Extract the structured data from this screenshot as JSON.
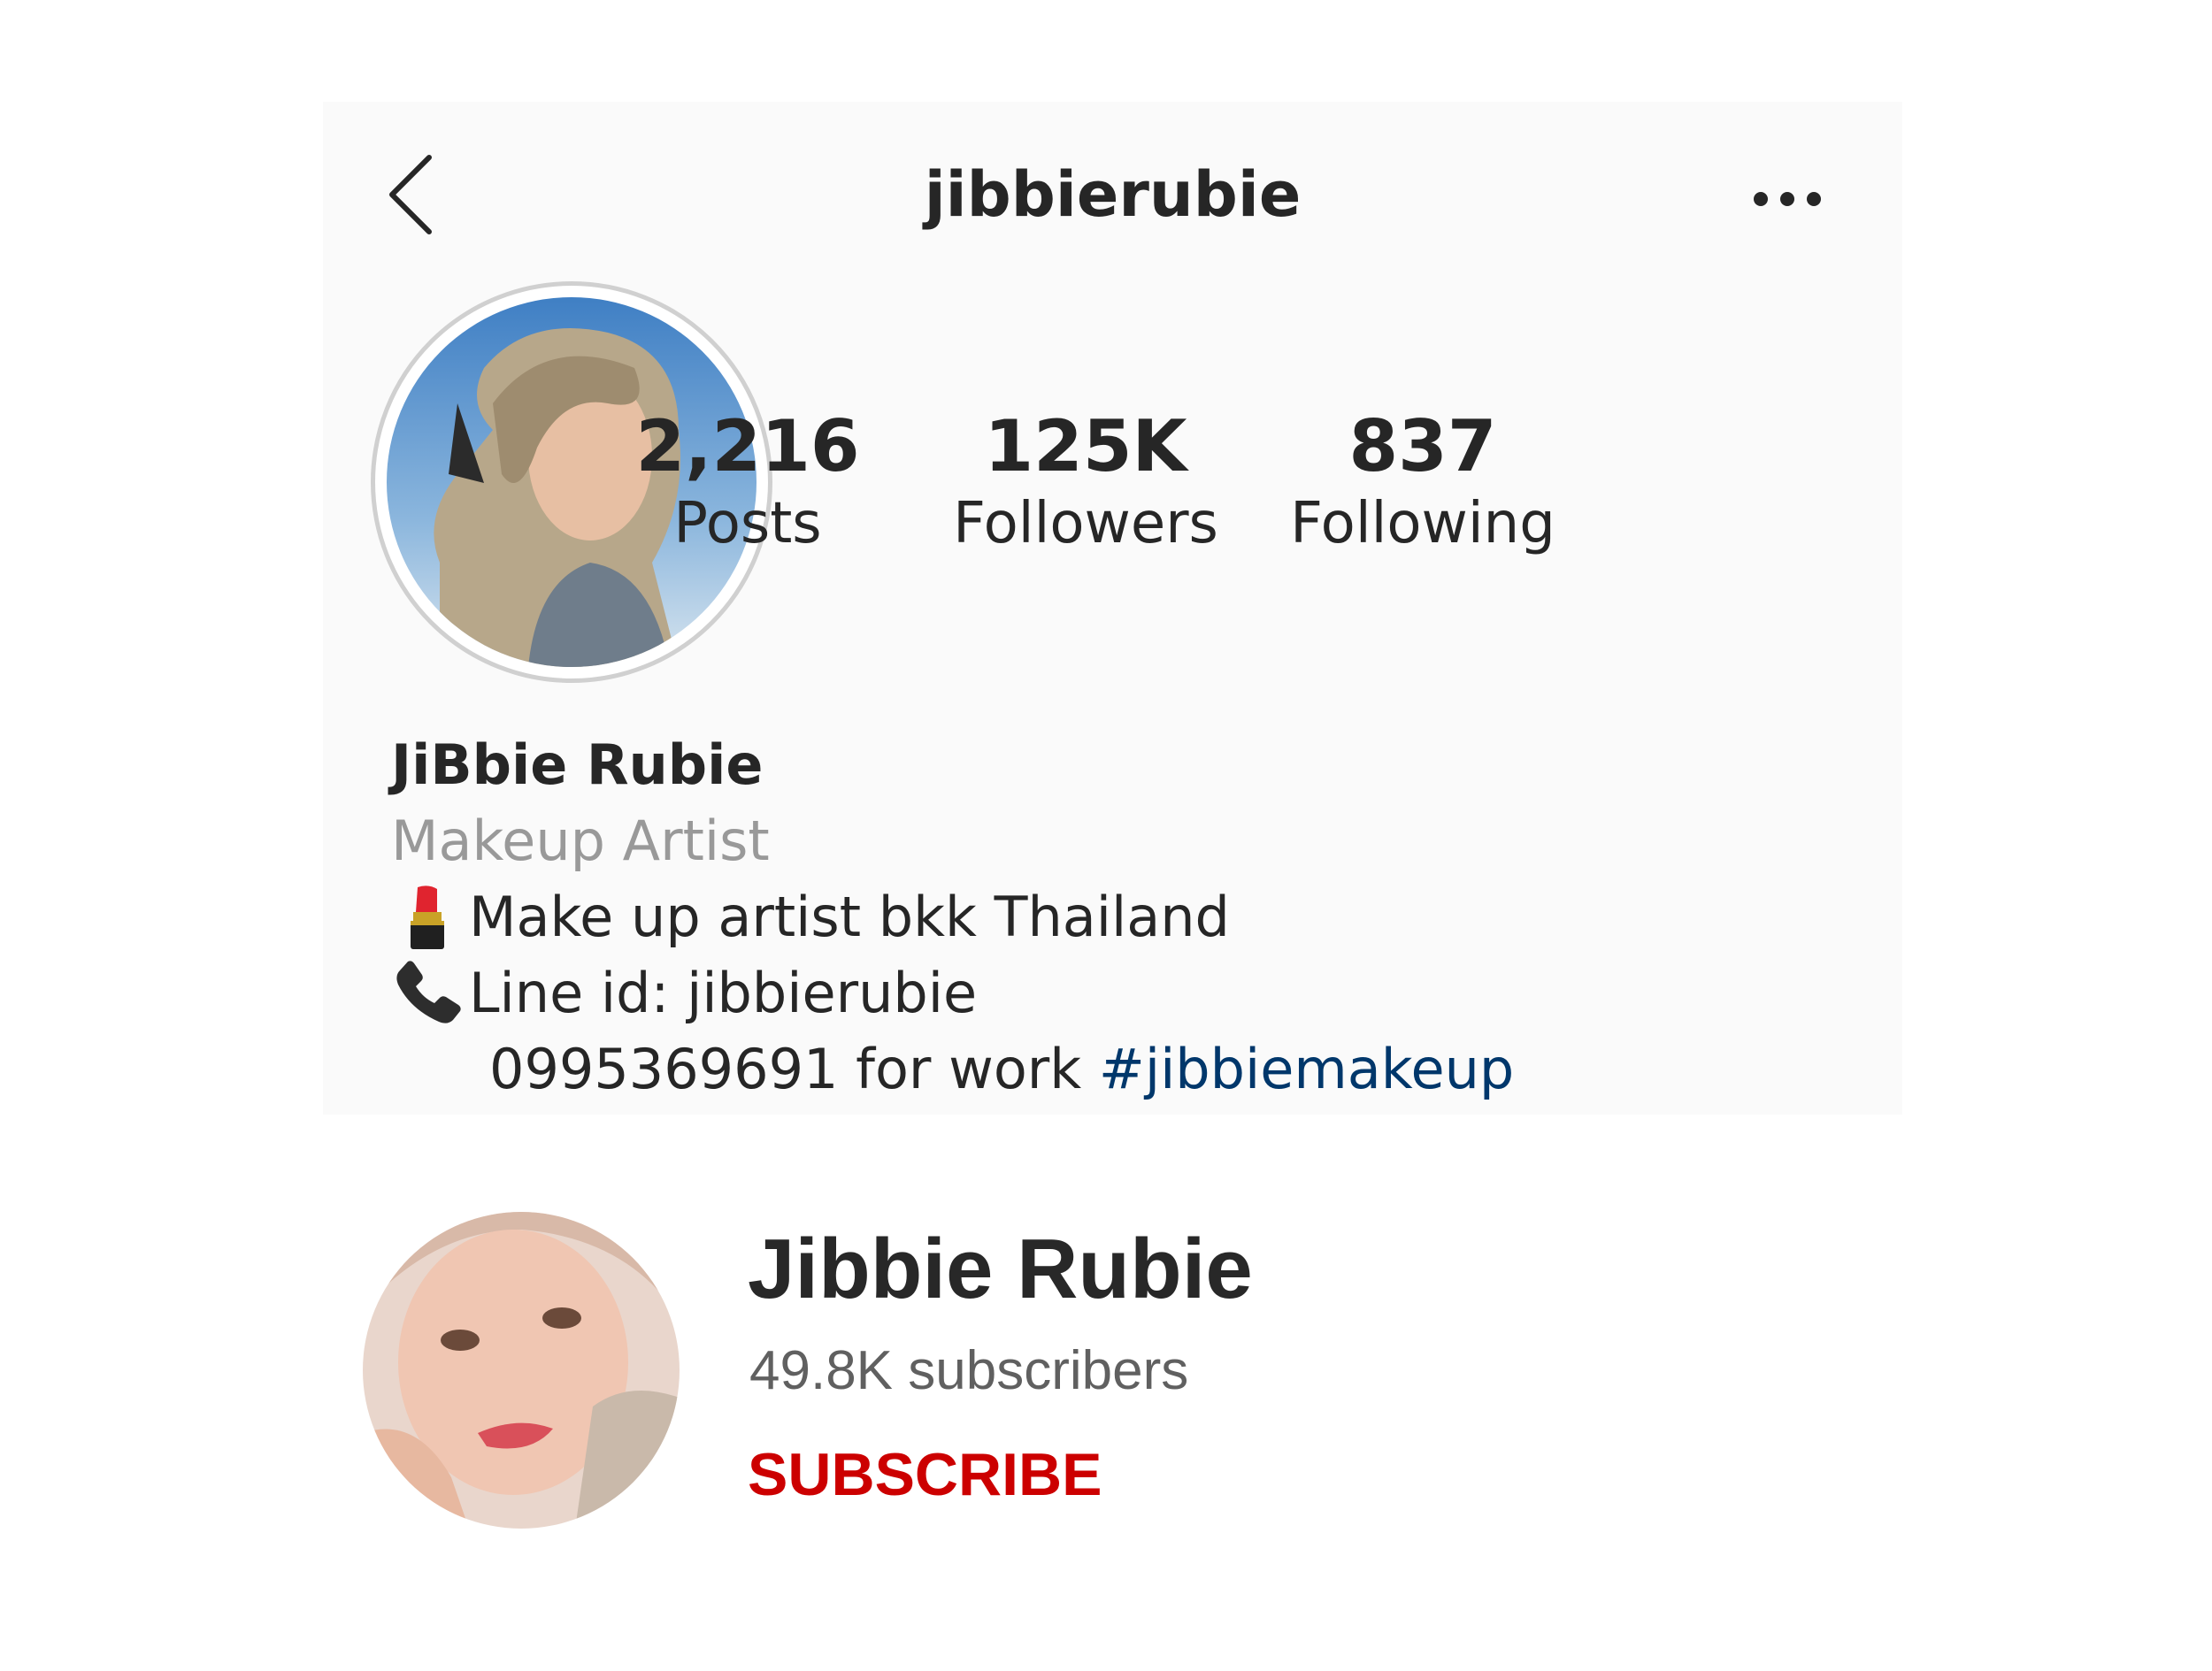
{
  "instagram": {
    "header": {
      "username": "jibbierubie"
    },
    "stats": [
      {
        "number": "2,216",
        "label": "Posts"
      },
      {
        "number": "125K",
        "label": "Followers"
      },
      {
        "number": "837",
        "label": "Following"
      }
    ],
    "profile": {
      "display_name": "JiBbie Rubie",
      "category": "Makeup Artist",
      "bio_line_1": "Make up artist bkk Thailand",
      "bio_line_2": "Line id: jibbierubie",
      "bio_line_3": "0995369691 for work",
      "hashtag": "#jibbiemakeup"
    },
    "icons": {
      "back": "chevron-left-icon",
      "more": "more-horizontal-icon",
      "bio_line_1": "lipstick-icon",
      "bio_line_2": "telephone-icon"
    },
    "colors": {
      "card_background": "#fafafa",
      "hashtag": "#00376b",
      "category": "#999999"
    }
  },
  "youtube": {
    "channel_name": "Jibbie Rubie",
    "subscribers": "49.8K subscribers",
    "subscribe_label": "SUBSCRIBE",
    "colors": {
      "subscribe": "#cc0000"
    }
  }
}
